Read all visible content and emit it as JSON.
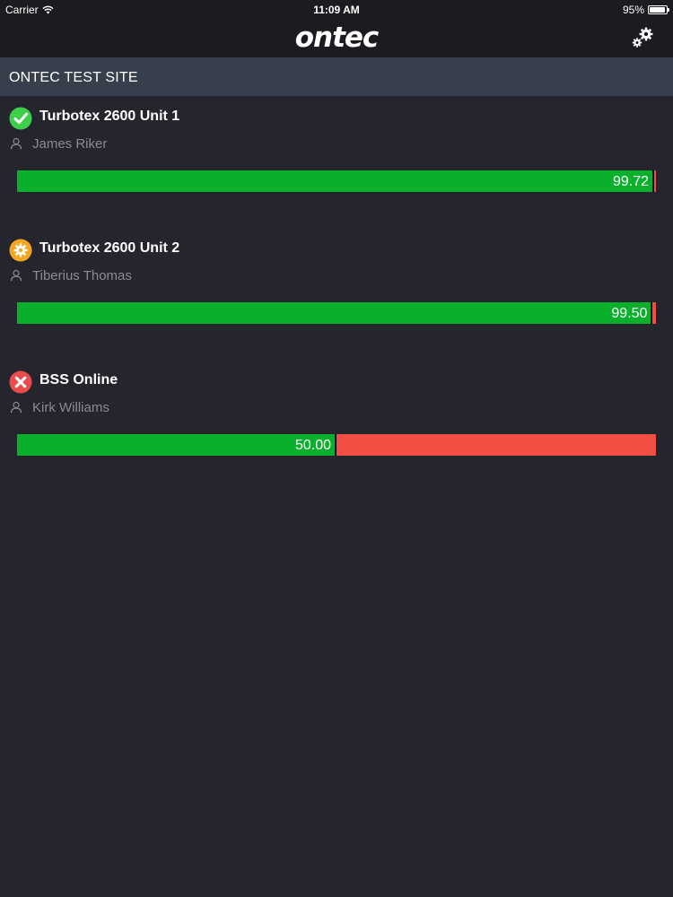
{
  "status_bar": {
    "carrier": "Carrier",
    "time": "11:09 AM",
    "battery_text": "95%",
    "battery_level": 0.95
  },
  "nav": {
    "logo": "ontec",
    "settings_icon": "gears-icon"
  },
  "site": {
    "name": "ONTEC TEST SITE"
  },
  "colors": {
    "good": "#0aaf2c",
    "bad": "#f14e44",
    "ok_icon": "#3ecf4a",
    "warning_icon": "#f5a623",
    "error_icon": "#e84c4c"
  },
  "items": [
    {
      "name": "Turbotex 2600 Unit 1",
      "assignee": "James Riker",
      "status": "ok",
      "status_icon": "check-circle-icon",
      "value_text": "99.72",
      "percent": 99.72
    },
    {
      "name": "Turbotex 2600 Unit 2",
      "assignee": "Tiberius Thomas",
      "status": "warning",
      "status_icon": "gear-warning-icon",
      "value_text": "99.50",
      "percent": 99.5
    },
    {
      "name": "BSS Online",
      "assignee": "Kirk Williams",
      "status": "error",
      "status_icon": "x-circle-icon",
      "value_text": "50.00",
      "percent": 50.0
    }
  ]
}
